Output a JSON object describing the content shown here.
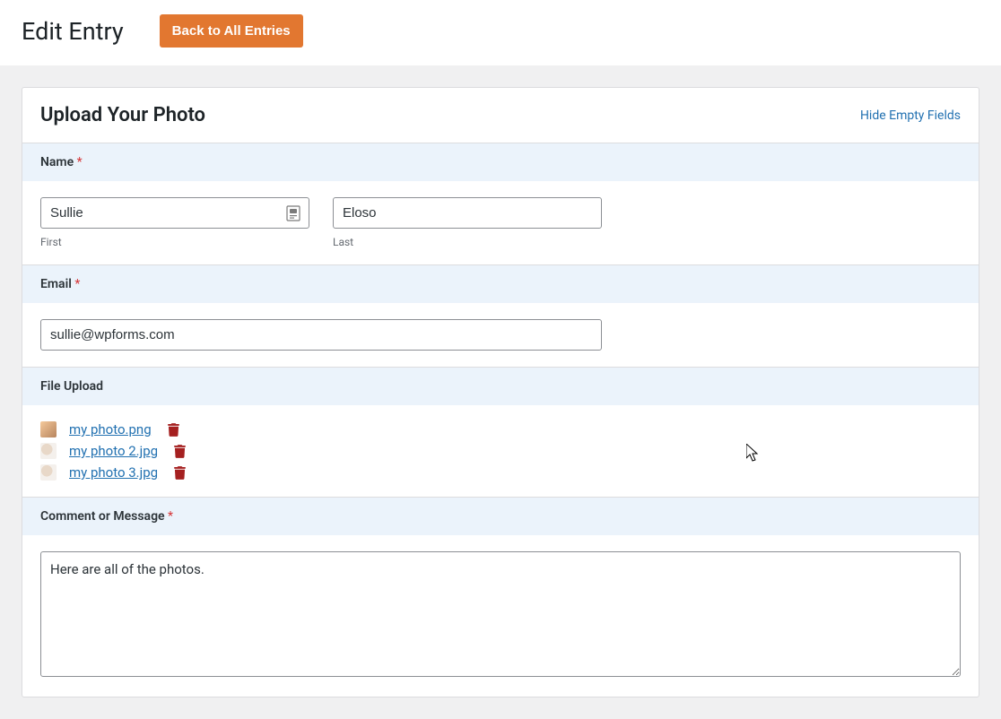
{
  "header": {
    "title": "Edit Entry",
    "back_button": "Back to All Entries"
  },
  "panel": {
    "title": "Upload Your Photo",
    "hide_empty": "Hide Empty Fields"
  },
  "fields": {
    "name": {
      "label": "Name",
      "first_value": "Sullie",
      "first_sublabel": "First",
      "last_value": "Eloso",
      "last_sublabel": "Last"
    },
    "email": {
      "label": "Email",
      "value": "sullie@wpforms.com"
    },
    "file_upload": {
      "label": "File Upload",
      "files": [
        "my photo.png",
        "my photo 2.jpg",
        "my photo 3.jpg"
      ]
    },
    "comment": {
      "label": "Comment or Message",
      "value": "Here are all of the photos."
    }
  }
}
